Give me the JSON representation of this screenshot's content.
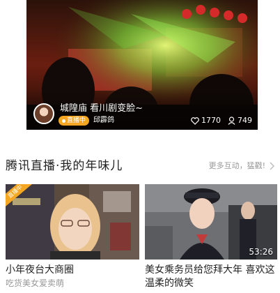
{
  "featured": {
    "title": "城隍庙 看川剧变脸~",
    "live_label": "直播中",
    "host_name": "邱霹鸽",
    "likes": "1770",
    "viewers": "749"
  },
  "section": {
    "title": "腾讯直播·我的年味儿",
    "more_label": "更多互动，猛戳!"
  },
  "cards": [
    {
      "tag": "直播中",
      "title": "小年夜台大商圈",
      "subtitle": "吃货美女爱卖萌"
    },
    {
      "duration": "53:26",
      "title": "美女乘务员给您拜大年 喜欢这温柔的微笑"
    }
  ],
  "icons": {
    "likes": "heart-icon",
    "viewers": "person-icon",
    "more": "chevron-right-icon"
  },
  "colors": {
    "live_badge": "#f5a623",
    "muted_text": "#999999"
  }
}
